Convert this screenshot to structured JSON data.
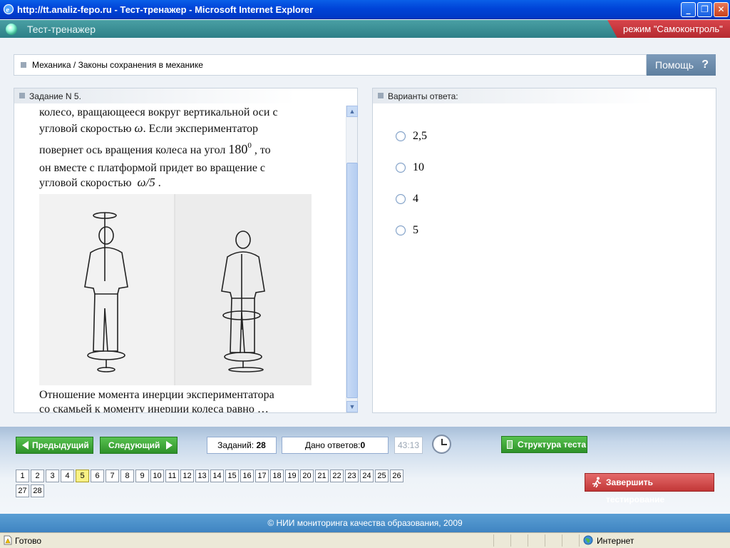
{
  "window": {
    "title": "http://tt.analiz-fepo.ru - Тест-тренажер - Microsoft Internet Explorer",
    "minimize": "_",
    "restore": "❐",
    "close": "✕"
  },
  "app": {
    "title": "Тест-тренажер",
    "mode": "режим \"Самоконтроль\""
  },
  "breadcrumb": "Механика / Законы сохранения в механике",
  "help": {
    "label": "Помощь",
    "icon": "?"
  },
  "task": {
    "header": "Задание N 5.",
    "lines": [
      "колесо, вращающееся вокруг вертикальной оси с",
      "угловой скоростью",
      ". Если экспериментатор",
      "повернет ось вращения колеса на угол",
      ", то",
      "он вместе с платформой придет во вращение с",
      "угловой скоростью",
      ".",
      "Отношение момента инерции экспериментатора",
      "со скамьей к моменту инерции колеса равно …"
    ],
    "omega": "ω",
    "angle_value": "180",
    "angle_sup": "0",
    "omega_fraction": "ω/5"
  },
  "answers": {
    "header": "Варианты ответа:",
    "options": [
      "2,5",
      "10",
      "4",
      "5"
    ]
  },
  "nav": {
    "prev": "Предыдущий",
    "next": "Следующий",
    "tasks_label": "Заданий:",
    "tasks_count": "28",
    "answered_label": "Дано ответов:",
    "answered_count": "0",
    "timer": "43:13",
    "structure": "Структура теста",
    "finish": "Завершить тестирование",
    "current": "5",
    "numbers": [
      "1",
      "2",
      "3",
      "4",
      "5",
      "6",
      "7",
      "8",
      "9",
      "10",
      "11",
      "12",
      "13",
      "14",
      "15",
      "16",
      "17",
      "18",
      "19",
      "20",
      "21",
      "22",
      "23",
      "24",
      "25",
      "26",
      "27",
      "28"
    ]
  },
  "footer": "© НИИ мониторинга качества образования, 2009",
  "status": {
    "ready": "Готово",
    "zone": "Интернет"
  }
}
